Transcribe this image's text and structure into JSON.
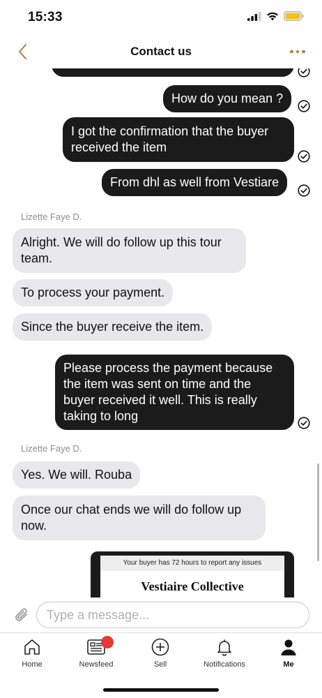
{
  "status_bar": {
    "time": "15:33"
  },
  "header": {
    "title": "Contact us"
  },
  "messages": {
    "m0": "",
    "m1": "How do you mean ?",
    "m2": "I got the confirmation that the buyer received the item",
    "m3": "From dhl as well from Vestiare",
    "sender1": "Lizette Faye D.",
    "m4": "Alright. We will do follow up this tour team.",
    "m5": "To process your payment.",
    "m6": "Since the buyer receive the item.",
    "m7": "Please process the payment because the item was sent on time and the buyer received it well. This is really taking to long",
    "sender2": "Lizette Faye D.",
    "m8": "Yes. We will. Rouba",
    "m9": "Once our chat ends we will do follow up now."
  },
  "card": {
    "note": "Your buyer has 72 hours to report any issues",
    "brand": "Vestiaire Collective"
  },
  "input": {
    "placeholder": "Type a message..."
  },
  "tabs": [
    {
      "label": "Home",
      "icon": "home-icon"
    },
    {
      "label": "Newsfeed",
      "icon": "newsfeed-icon"
    },
    {
      "label": "Sell",
      "icon": "plus-circle-icon"
    },
    {
      "label": "Notifications",
      "icon": "bell-icon"
    },
    {
      "label": "Me",
      "icon": "person-icon"
    }
  ],
  "colors": {
    "accent": "#b47a4a",
    "outgoing_bubble": "#1b1b1b",
    "incoming_bubble": "#e8e8ea",
    "badge": "#e53935"
  }
}
